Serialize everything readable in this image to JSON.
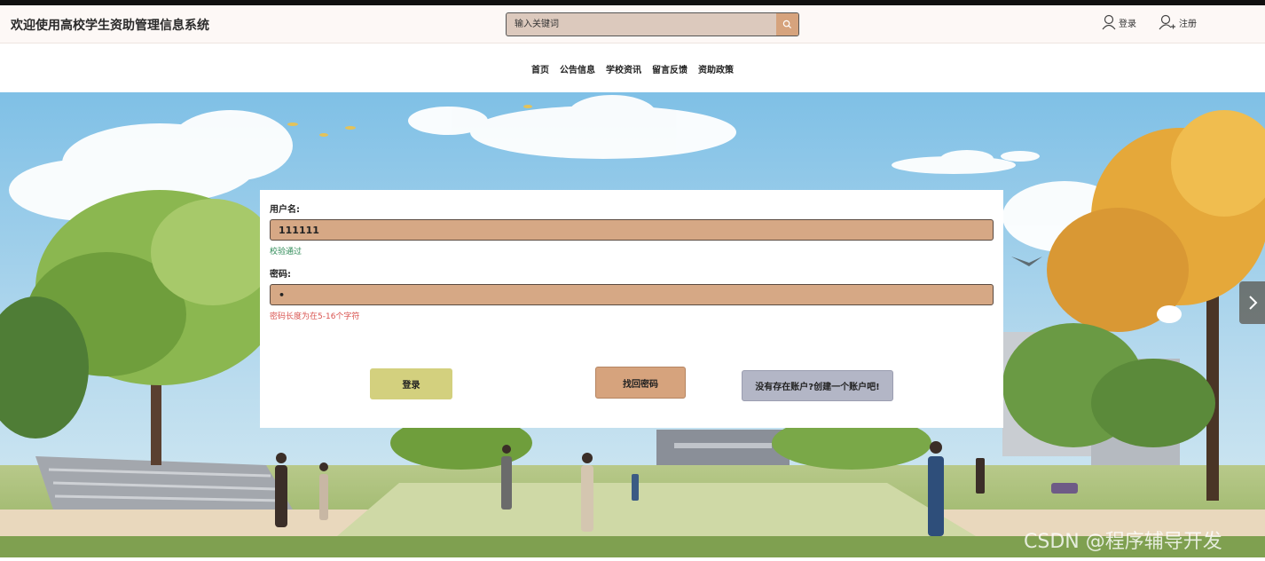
{
  "header": {
    "site_title": "欢迎使用高校学生资助管理信息系统",
    "search_placeholder": "输入关键词",
    "login_label": "登录",
    "register_label": "注册"
  },
  "nav": {
    "items": [
      "首页",
      "公告信息",
      "学校资讯",
      "留言反馈",
      "资助政策"
    ]
  },
  "login_form": {
    "username_label": "用户名:",
    "username_value": "111111",
    "username_hint": "校验通过",
    "password_label": "密码:",
    "password_value": "•",
    "password_hint": "密码长度为在5-16个字符",
    "login_button": "登录",
    "forgot_button": "找回密码",
    "register_button": "没有存在账户?创建一个账户吧!"
  },
  "colors": {
    "input_bg": "#d6a885",
    "login_btn": "#d3d07e",
    "forgot_btn": "#d6a37d",
    "register_btn": "#b3b6c6",
    "ok_hint": "#2e8b57",
    "err_hint": "#d9534f"
  },
  "watermark": "CSDN @程序辅导开发"
}
